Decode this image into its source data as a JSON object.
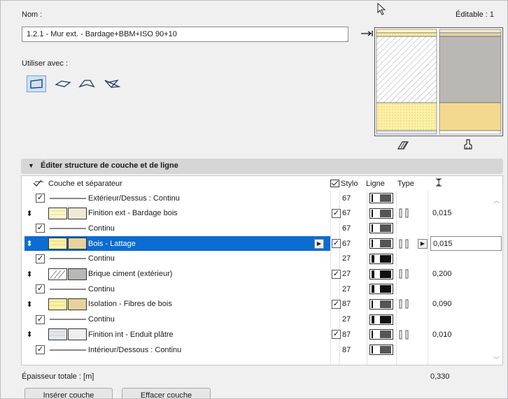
{
  "header": {
    "name_label": "Nom :",
    "editable_label": "Éditable : 1",
    "name_value": "1.2.1 - Mur ext. - Bardage+BBM+ISO 90+10",
    "use_with_label": "Utiliser avec :"
  },
  "shapes": [
    "wall-shape-icon",
    "slab-shape-icon",
    "roof-shape-icon",
    "shell-shape-icon"
  ],
  "section": {
    "title": "Éditer structure de couche et de ligne"
  },
  "table": {
    "col_layer": "Couche et séparateur",
    "col_pen": "Stylo",
    "col_line": "Ligne",
    "col_type": "Type",
    "rows": [
      {
        "kind": "line",
        "name": "Extérieur/Dessus : Continu",
        "pen": "67",
        "thickness": "",
        "line_weight": "thin"
      },
      {
        "kind": "layer",
        "name": "Finition ext - Bardage bois",
        "pen": "67",
        "thickness": "0,015",
        "fill": "#fff6cc",
        "line_weight": "thin"
      },
      {
        "kind": "line",
        "name": "Continu",
        "pen": "67",
        "thickness": "",
        "line_weight": "thin"
      },
      {
        "kind": "layer",
        "name": "Bois - Lattage",
        "pen": "67",
        "thickness": "0,015",
        "fill": "#fff1a8",
        "selected": true,
        "line_weight": "thin"
      },
      {
        "kind": "line",
        "name": "Continu",
        "pen": "27",
        "thickness": "",
        "line_weight": "thick"
      },
      {
        "kind": "layer",
        "name": "Brique ciment (extérieur)",
        "pen": "27",
        "thickness": "0,200",
        "fill": "#ffffff",
        "line_weight": "thick"
      },
      {
        "kind": "line",
        "name": "Continu",
        "pen": "27",
        "thickness": "",
        "line_weight": "thick"
      },
      {
        "kind": "layer",
        "name": "Isolation - Fibres de bois",
        "pen": "87",
        "thickness": "0,090",
        "fill": "#fff1a8",
        "line_weight": "thin"
      },
      {
        "kind": "line",
        "name": "Continu",
        "pen": "27",
        "thickness": "",
        "line_weight": "thick"
      },
      {
        "kind": "layer",
        "name": "Finition int - Enduit plâtre",
        "pen": "87",
        "thickness": "0,010",
        "fill": "#dfe8f7",
        "line_weight": "thin"
      },
      {
        "kind": "line",
        "name": "Intérieur/Dessous : Continu",
        "pen": "87",
        "thickness": "",
        "line_weight": "thin"
      }
    ]
  },
  "footer": {
    "total_label": "Épaisseur totale : [m]",
    "total_value": "0,330",
    "insert_button": "Insérer couche",
    "delete_button": "Effacer couche"
  },
  "colors": {
    "selection": "#0b6cd1",
    "accent_yellow": "#f2d98f",
    "accent_grey": "#b9b8b5"
  }
}
